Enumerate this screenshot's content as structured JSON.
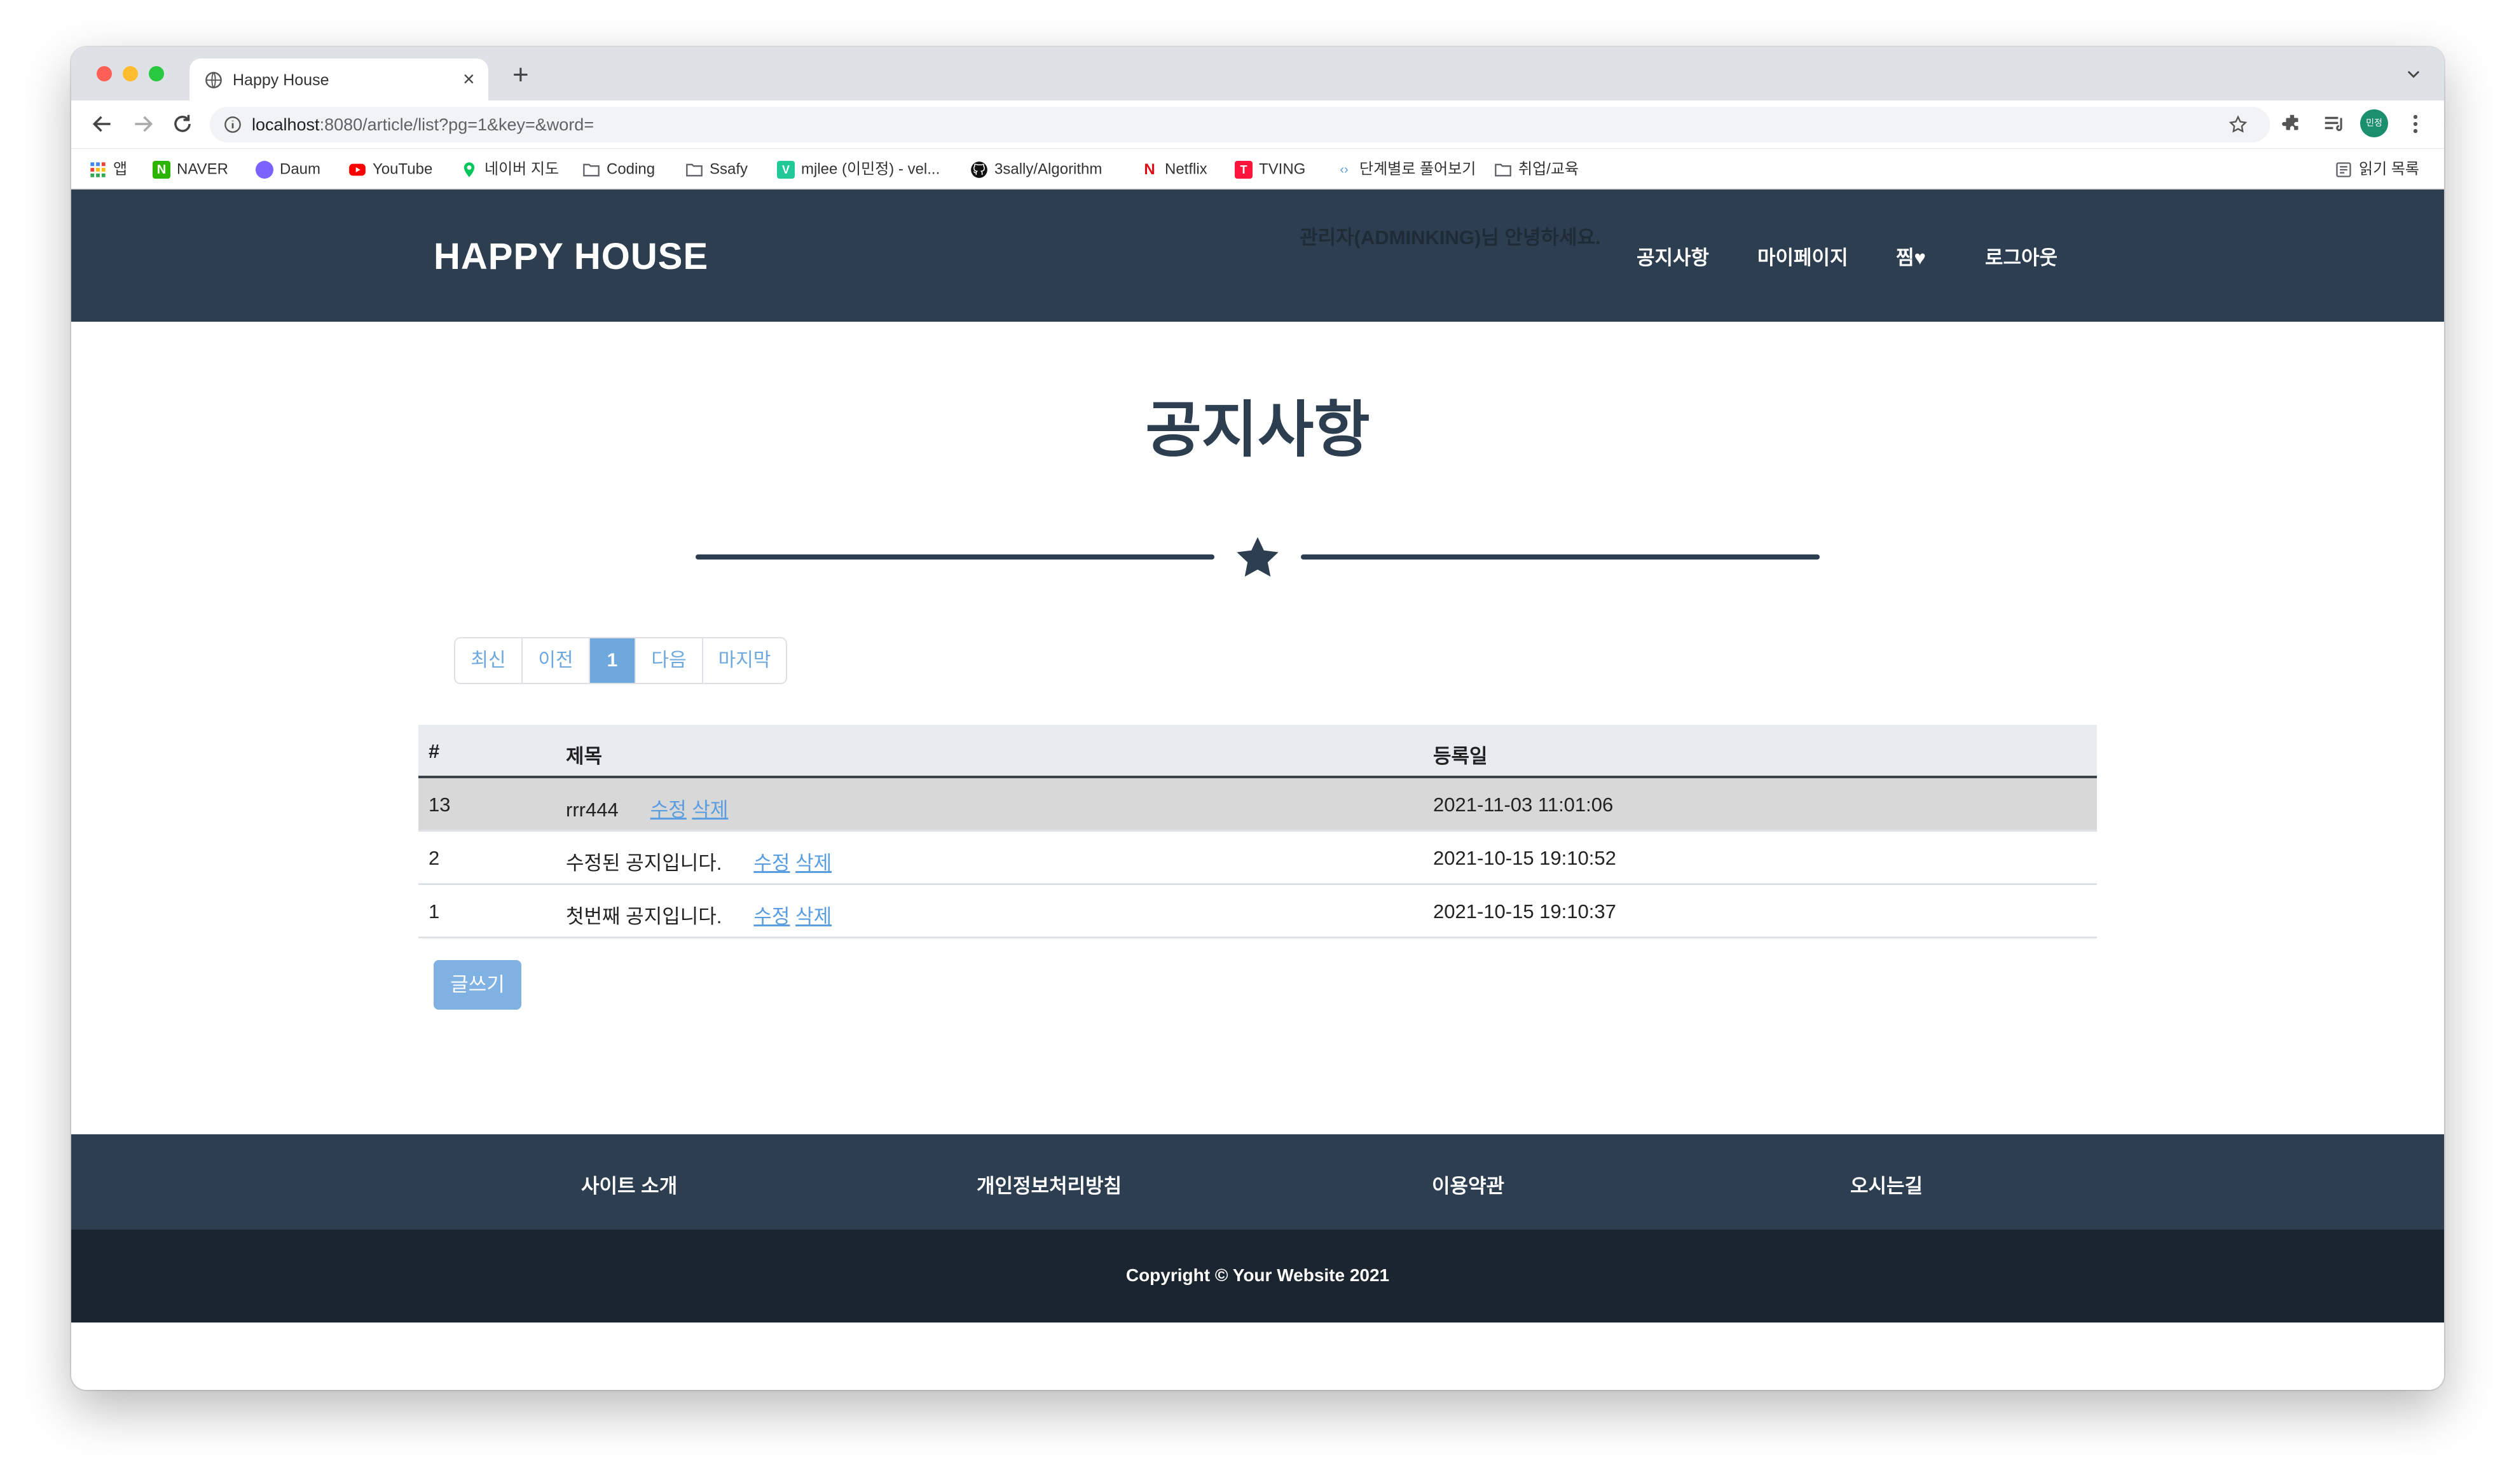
{
  "browser": {
    "tab_title": "Happy House",
    "url_host": "localhost",
    "url_rest": ":8080/article/list?pg=1&key=&word=",
    "profile_label": "민정"
  },
  "bookmarks": [
    {
      "label": "앱",
      "icon": "apps-grid-icon",
      "color": "#4285f4"
    },
    {
      "label": "NAVER",
      "icon": "naver-icon",
      "color": "#2db400"
    },
    {
      "label": "Daum",
      "icon": "daum-icon",
      "color": "#7b61ff"
    },
    {
      "label": "YouTube",
      "icon": "youtube-icon",
      "color": "#ff0000"
    },
    {
      "label": "네이버 지도",
      "icon": "naver-map-icon",
      "color": "#03c75a"
    },
    {
      "label": "Coding",
      "icon": "folder-icon",
      "color": "#5f6368"
    },
    {
      "label": "Ssafy",
      "icon": "folder-icon",
      "color": "#5f6368"
    },
    {
      "label": "mjlee (이민정) - vel...",
      "icon": "velog-icon",
      "color": "#20c997"
    },
    {
      "label": "3sally/Algorithm",
      "icon": "github-icon",
      "color": "#000000"
    },
    {
      "label": "Netflix",
      "icon": "netflix-icon",
      "color": "#e50914"
    },
    {
      "label": "TVING",
      "icon": "tving-icon",
      "color": "#ff153c"
    },
    {
      "label": "단계별로 풀어보기",
      "icon": "code-icon",
      "color": "#5b9bd5"
    },
    {
      "label": "취업/교육",
      "icon": "folder-icon",
      "color": "#5f6368"
    }
  ],
  "reading_list": "읽기 목록",
  "header": {
    "brand": "HAPPY HOUSE",
    "greeting": "관리자(ADMINKING)님 안녕하세요.",
    "nav": {
      "notice": "공지사항",
      "mypage": "마이페이지",
      "favorites": "찜",
      "heart": "♥",
      "logout": "로그아웃"
    }
  },
  "main": {
    "title": "공지사항",
    "pagination": {
      "first": "최신",
      "prev": "이전",
      "current": "1",
      "next": "다음",
      "last": "마지막"
    },
    "table": {
      "headers": {
        "no": "#",
        "subject": "제목",
        "date": "등록일"
      },
      "rows": [
        {
          "no": "13",
          "subject": "rrr444",
          "edit": "수정",
          "delete": "삭제",
          "date": "2021-11-03 11:01:06"
        },
        {
          "no": "2",
          "subject": "수정된 공지입니다.",
          "edit": "수정",
          "delete": "삭제",
          "date": "2021-10-15 19:10:52"
        },
        {
          "no": "1",
          "subject": "첫번째 공지입니다.",
          "edit": "수정",
          "delete": "삭제",
          "date": "2021-10-15 19:10:37"
        }
      ]
    },
    "write_button": "글쓰기"
  },
  "footer": {
    "links": {
      "about": "사이트 소개",
      "privacy": "개인정보처리방침",
      "terms": "이용약관",
      "directions": "오시는길"
    },
    "copyright": "Copyright © Your Website 2021"
  },
  "colors": {
    "navbar": "#2c3e50",
    "footer_dark": "#1a252f",
    "accent": "#6fa8dc",
    "link": "#5a9ee0"
  }
}
